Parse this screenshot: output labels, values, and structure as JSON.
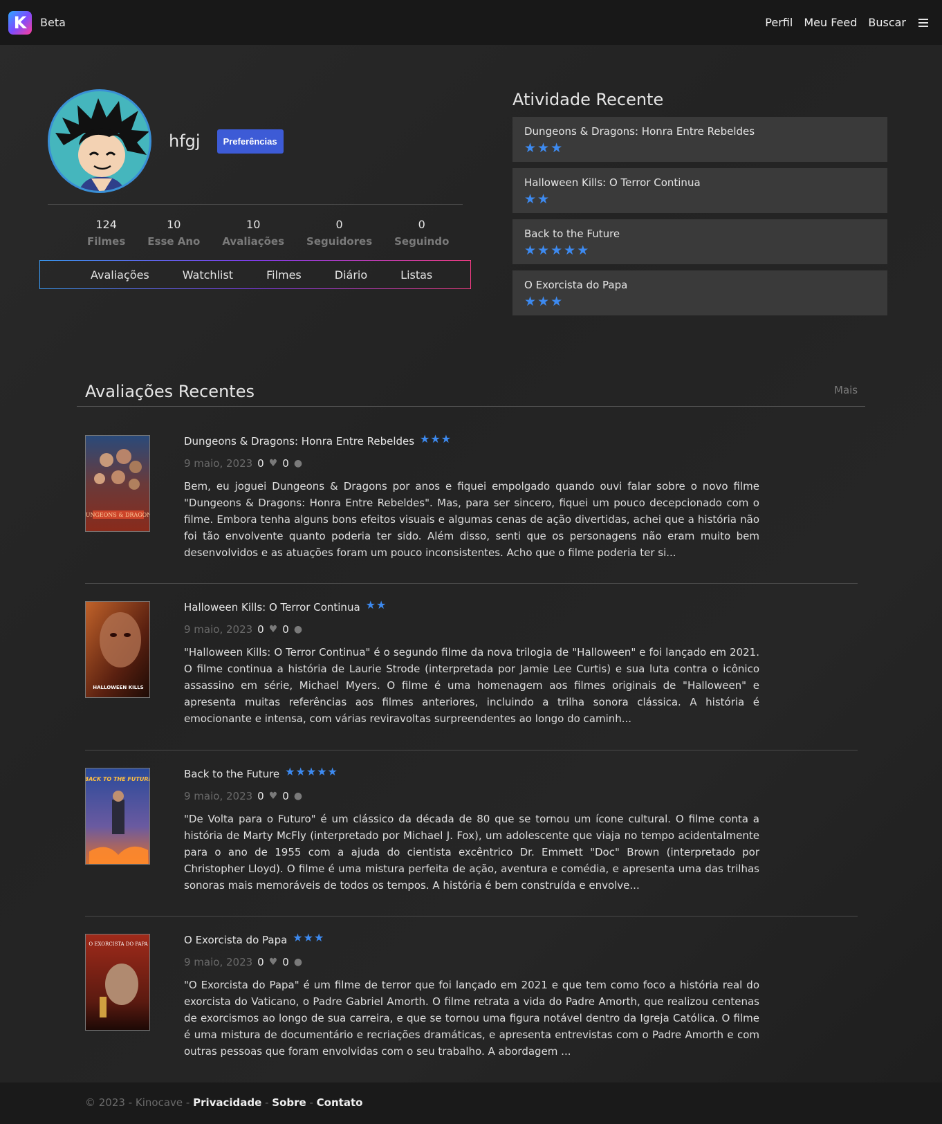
{
  "nav": {
    "brand_letter": "K",
    "brand_label": "Beta",
    "links": [
      "Perfil",
      "Meu Feed",
      "Buscar"
    ]
  },
  "profile": {
    "username": "hfgj",
    "preferences_label": "Preferências",
    "stats": [
      {
        "value": "124",
        "label": "Filmes"
      },
      {
        "value": "10",
        "label": "Esse Ano"
      },
      {
        "value": "10",
        "label": "Avaliações"
      },
      {
        "value": "0",
        "label": "Seguidores"
      },
      {
        "value": "0",
        "label": "Seguindo"
      }
    ],
    "tabs": [
      "Avaliações",
      "Watchlist",
      "Filmes",
      "Diário",
      "Listas"
    ]
  },
  "activity": {
    "title": "Atividade Recente",
    "items": [
      {
        "title": "Dungeons & Dragons: Honra Entre Rebeldes",
        "stars": 3
      },
      {
        "title": "Halloween Kills: O Terror Continua",
        "stars": 2
      },
      {
        "title": "Back to the Future",
        "stars": 5
      },
      {
        "title": "O Exorcista do Papa",
        "stars": 3
      }
    ]
  },
  "reviews": {
    "title": "Avaliações Recentes",
    "more_label": "Mais",
    "items": [
      {
        "title": "Dungeons & Dragons: Honra Entre Rebeldes",
        "stars": 3,
        "date": "9 maio, 2023",
        "likes": "0",
        "comments": "0",
        "poster_text": "DUNGEONS & DRAGONS",
        "text": "Bem, eu joguei Dungeons & Dragons por anos e fiquei empolgado quando ouvi falar sobre o novo filme \"Dungeons & Dragons: Honra Entre Rebeldes\". Mas, para ser sincero, fiquei um pouco decepcionado com o filme. Embora tenha alguns bons efeitos visuais e algumas cenas de ação divertidas, achei que a história não foi tão envolvente quanto poderia ter sido. Além disso, senti que os personagens não eram muito bem desenvolvidos e as atuações foram um pouco inconsistentes. Acho que o filme poderia ter si..."
      },
      {
        "title": "Halloween Kills: O Terror Continua",
        "stars": 2,
        "date": "9 maio, 2023",
        "likes": "0",
        "comments": "0",
        "poster_text": "HALLOWEEN KILLS",
        "text": "\"Halloween Kills: O Terror Continua\" é o segundo filme da nova trilogia de \"Halloween\" e foi lançado em 2021. O filme continua a história de Laurie Strode (interpretada por Jamie Lee Curtis) e sua luta contra o icônico assassino em série, Michael Myers. O filme é uma homenagem aos filmes originais de \"Halloween\" e apresenta muitas referências aos filmes anteriores, incluindo a trilha sonora clássica. A história é emocionante e intensa, com várias reviravoltas surpreendentes ao longo do caminh..."
      },
      {
        "title": "Back to the Future",
        "stars": 5,
        "date": "9 maio, 2023",
        "likes": "0",
        "comments": "0",
        "poster_text": "BACK TO THE FUTURE",
        "text": "\"De Volta para o Futuro\" é um clássico da década de 80 que se tornou um ícone cultural. O filme conta a história de Marty McFly (interpretado por Michael J. Fox), um adolescente que viaja no tempo acidentalmente para o ano de 1955 com a ajuda do cientista excêntrico Dr. Emmett \"Doc\" Brown (interpretado por Christopher Lloyd). O filme é uma mistura perfeita de ação, aventura e comédia, e apresenta uma das trilhas sonoras mais memoráveis de todos os tempos. A história é bem construída e envolve..."
      },
      {
        "title": "O Exorcista do Papa",
        "stars": 3,
        "date": "9 maio, 2023",
        "likes": "0",
        "comments": "0",
        "poster_text": "O EXORCISTA DO PAPA",
        "text": "\"O Exorcista do Papa\" é um filme de terror que foi lançado em 2021 e que tem como foco a história real do exorcista do Vaticano, o Padre Gabriel Amorth. O filme retrata a vida do Padre Amorth, que realizou centenas de exorcismos ao longo de sua carreira, e que se tornou uma figura notável dentro da Igreja Católica. O filme é uma mistura de documentário e recriações dramáticas, e apresenta entrevistas com o Padre Amorth e com outras pessoas que foram envolvidas com o seu trabalho. A abordagem ..."
      }
    ]
  },
  "footer": {
    "copyright": "© 2023 - Kinocave - ",
    "privacy": "Privacidade",
    "about": "Sobre",
    "contact": "Contato",
    "dash": " - "
  },
  "colors": {
    "accent": "#3d5bd6",
    "star": "#3d8af0",
    "background": "#262626"
  }
}
